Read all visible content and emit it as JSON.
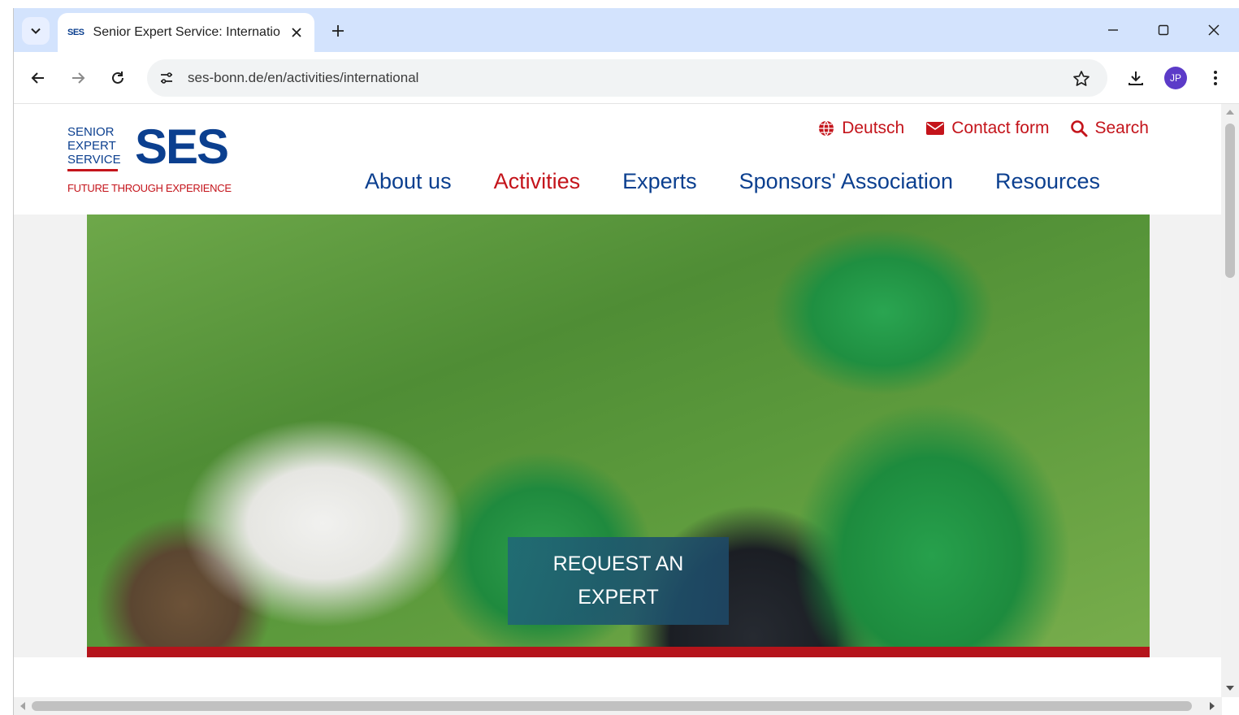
{
  "browser": {
    "tab": {
      "favicon_text": "SES",
      "title": "Senior Expert Service: International"
    },
    "url": "ses-bonn.de/en/activities/international",
    "profile_initials": "JP"
  },
  "site": {
    "logo": {
      "small_line1": "SENIOR",
      "small_line2": "EXPERT",
      "small_line3": "SERVICE",
      "big": "SES",
      "tagline": "FUTURE THROUGH EXPERIENCE"
    },
    "topbar": {
      "language": "Deutsch",
      "contact": "Contact form",
      "search": "Search"
    },
    "nav": {
      "about": "About us",
      "activities": "Activities",
      "experts": "Experts",
      "sponsors": "Sponsors' Association",
      "resources": "Resources"
    },
    "hero": {
      "cta": "REQUEST AN EXPERT"
    }
  },
  "colors": {
    "brand_blue": "#0b3f8f",
    "brand_red": "#c4141b",
    "tab_strip": "#d3e3fd"
  }
}
